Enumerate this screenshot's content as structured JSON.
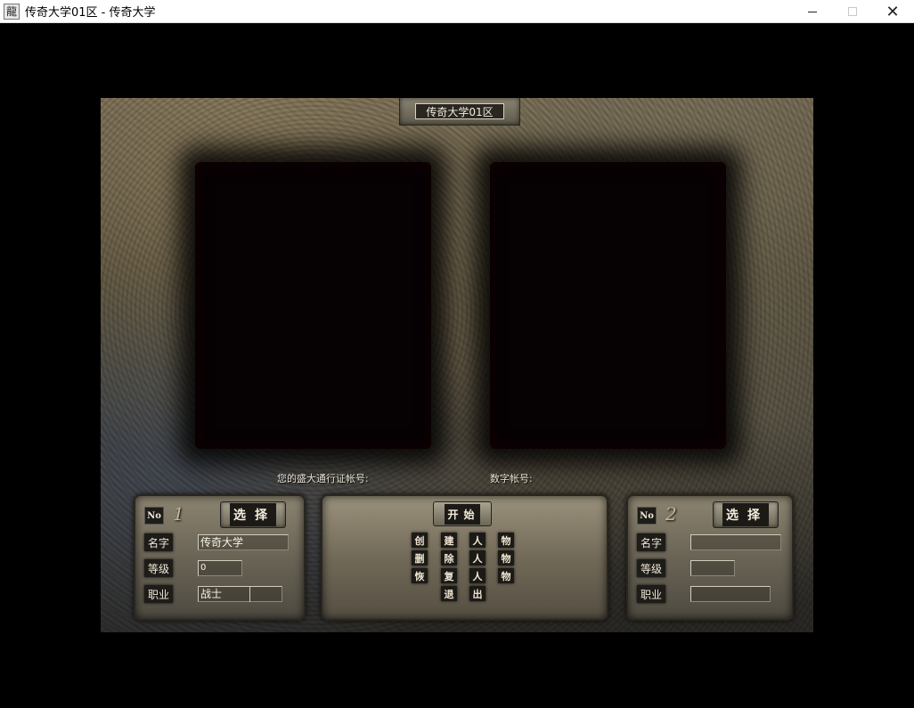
{
  "window": {
    "title": "传奇大学01区 - 传奇大学",
    "icon_glyph": "龍",
    "minimize": "minimize",
    "maximize": "maximize",
    "close": "✕"
  },
  "server": {
    "name": "传奇大学01区"
  },
  "account": {
    "pass_label": "您的盛大通行证帐号:",
    "digital_label": "数字帐号:"
  },
  "slot1": {
    "no_label": "No",
    "no_number": "1",
    "select_label": "选择",
    "name_label": "名字",
    "level_label": "等级",
    "job_label": "职业",
    "name_value": "传奇大学",
    "level_value": "0",
    "job_value": "战士"
  },
  "slot2": {
    "no_label": "No",
    "no_number": "2",
    "select_label": "选择",
    "name_label": "名字",
    "level_label": "等级",
    "job_label": "职业",
    "name_value": "",
    "level_value": "",
    "job_value": ""
  },
  "menu": {
    "start_label": "开始",
    "create": [
      "创",
      "建",
      "人",
      "物"
    ],
    "delete": [
      "删",
      "除",
      "人",
      "物"
    ],
    "restore": [
      "恢",
      "复",
      "人",
      "物"
    ],
    "exit": [
      "退",
      "出"
    ]
  }
}
